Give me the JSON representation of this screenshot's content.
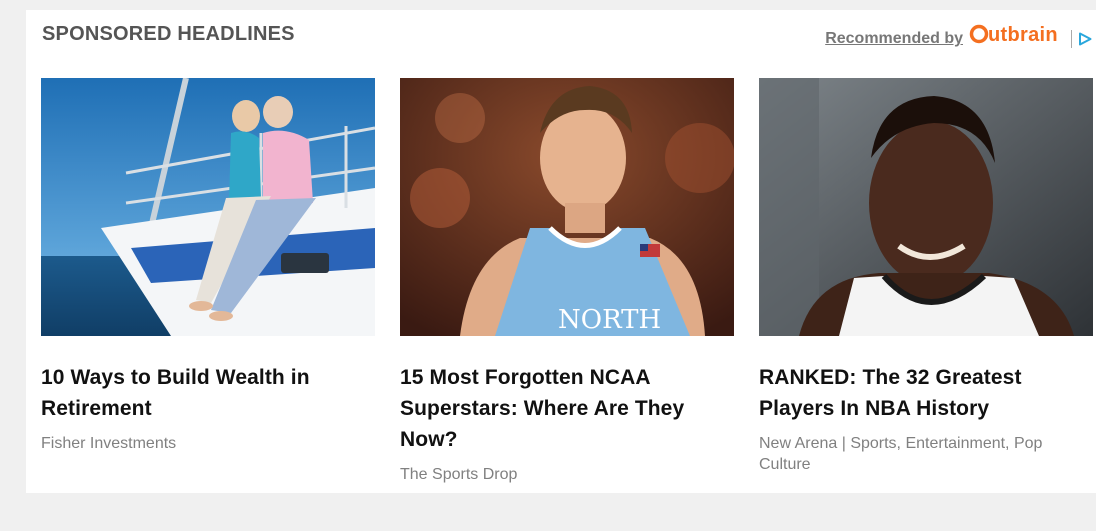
{
  "header": {
    "title": "SPONSORED HEADLINES",
    "recommended_label": "Recommended by",
    "brand": "Outbrain",
    "adchoice_icon": "play-triangle-icon",
    "accent_color": "#f46f20"
  },
  "cards": [
    {
      "title": "10 Ways to Build Wealth in Retirement",
      "source": "Fisher Investments"
    },
    {
      "title": "15 Most Forgotten NCAA Superstars: Where Are They Now?",
      "source": "The Sports Drop"
    },
    {
      "title": "RANKED: The 32 Greatest Players In NBA History",
      "source": "New Arena | Sports, Entertainment, Pop Culture"
    }
  ]
}
